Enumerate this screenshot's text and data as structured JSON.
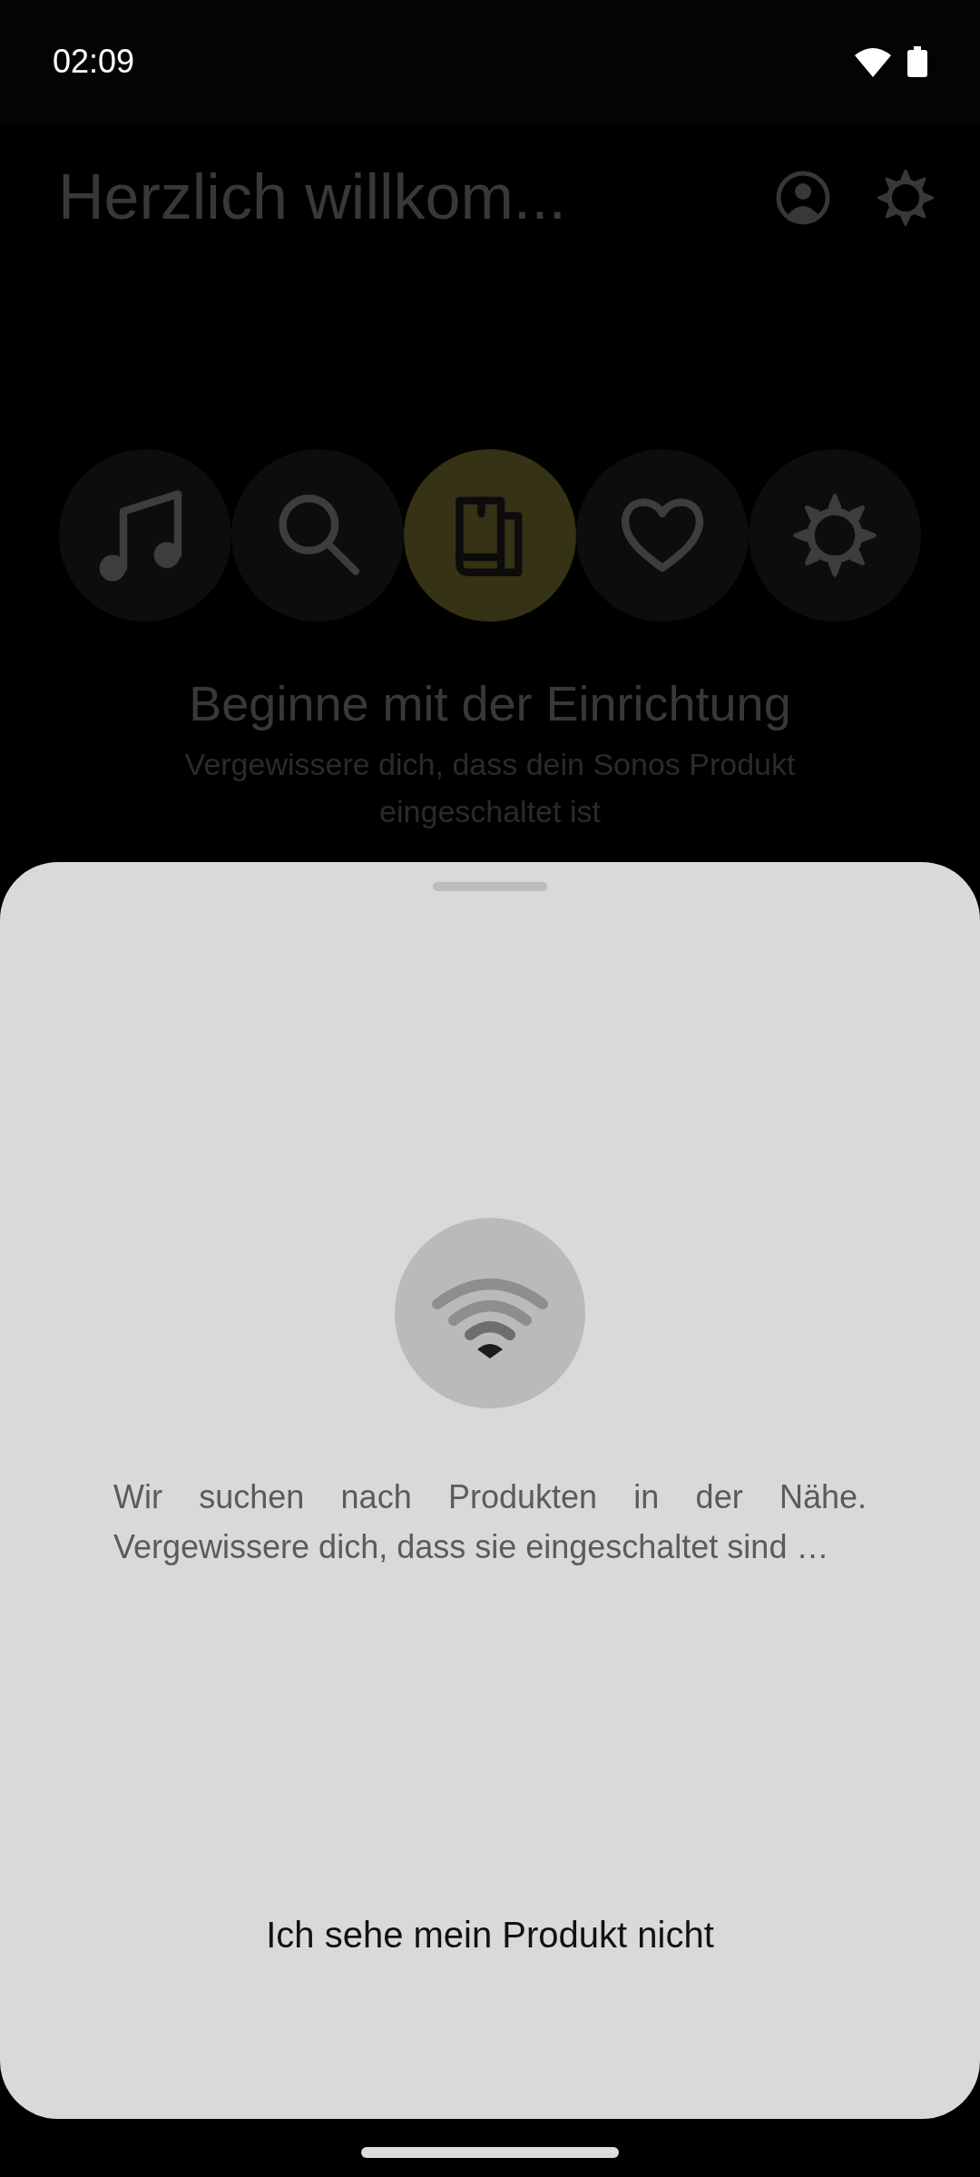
{
  "status_bar": {
    "time": "02:09"
  },
  "header": {
    "title": "Herzlich willkom..."
  },
  "categories": [
    {
      "selected": false
    },
    {
      "selected": false
    },
    {
      "selected": true
    },
    {
      "selected": false
    },
    {
      "selected": false
    }
  ],
  "intro": {
    "heading": "Beginne mit der Einrichtung",
    "text": "Vergewissere dich, dass dein Sonos Produkt eingeschaltet ist"
  },
  "sheet": {
    "message": "Wir suchen nach Produkten in der Nähe. Vergewissere dich, dass sie eingeschaltet sind …",
    "link": "Ich sehe mein Produkt nicht"
  }
}
